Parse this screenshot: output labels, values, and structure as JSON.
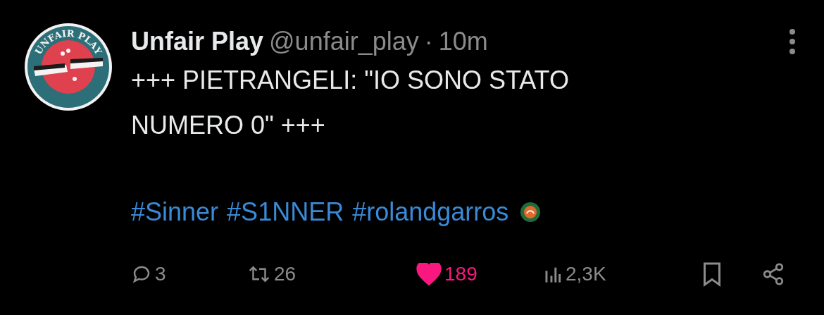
{
  "avatar": {
    "logo_text": "UNFAIR PLAY"
  },
  "author": {
    "name": "Unfair Play",
    "handle": "@unfair_play",
    "separator": "·",
    "time": "10m"
  },
  "text": "+++ PIETRANGELI: \"IO SONO STATO NUMERO 0\" +++",
  "hashtags": [
    "#Sinner",
    "#S1NNER",
    "#rolandgarros"
  ],
  "actions": [
    {
      "kind": "reply",
      "count": "3"
    },
    {
      "kind": "repost",
      "count": "26"
    },
    {
      "kind": "like",
      "count": "189",
      "selected": true
    },
    {
      "kind": "views",
      "count": "2,3K"
    },
    {
      "kind": "bookmark"
    },
    {
      "kind": "share"
    }
  ]
}
